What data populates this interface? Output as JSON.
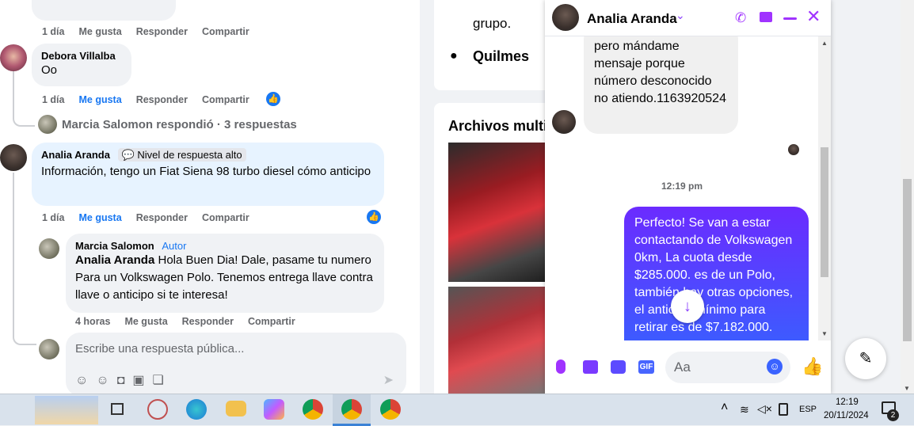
{
  "comments": [
    {
      "time": "1 día",
      "like": "Me gusta",
      "reply": "Responder",
      "share": "Compartir"
    },
    {
      "name": "Debora Villalba",
      "text": "Oo",
      "time": "1 día",
      "like": "Me gusta",
      "reply": "Responder",
      "share": "Compartir"
    },
    {
      "name": "Analia Aranda",
      "badge": "Nivel de respuesta alto",
      "text": "Información, tengo un Fiat Siena 98 turbo diesel cómo anticipo",
      "time": "1 día",
      "like": "Me gusta",
      "reply": "Responder",
      "share": "Compartir"
    }
  ],
  "replied": "Marcia Salomon respondió · 3 respuestas",
  "reply": {
    "name": "Marcia Salomon",
    "role": "Autor",
    "mention": "Analia Aranda",
    "text": " Hola Buen Dia! Dale, pasame tu numero Para un Volkswagen Polo. Tenemos entrega llave contra llave o anticipo si te interesa!",
    "time": "4 horas",
    "like": "Me gusta",
    "reply": "Responder",
    "share": "Compartir"
  },
  "composer": {
    "placeholder": "Escribe una respuesta pública..."
  },
  "side": {
    "group": "grupo.",
    "location": "Quilmes",
    "files_title": "Archivos multi"
  },
  "chat": {
    "name": "Analia Aranda",
    "incoming": "pero mándame mensaje porque número desconocido no atiendo.1163920524",
    "time": "12:19 pm",
    "outgoing": "Perfecto!  Se van a estar contactando de Volkswagen 0km, La cuota desde $285.000. es de un Polo, también hay otras opciones, el anticipo mínimo para retirar es de $7.182.000.",
    "input_placeholder": "Aa"
  },
  "taskbar": {
    "time": "12:19",
    "date": "20/11/2024",
    "lang": "ESP",
    "notif": "2"
  }
}
